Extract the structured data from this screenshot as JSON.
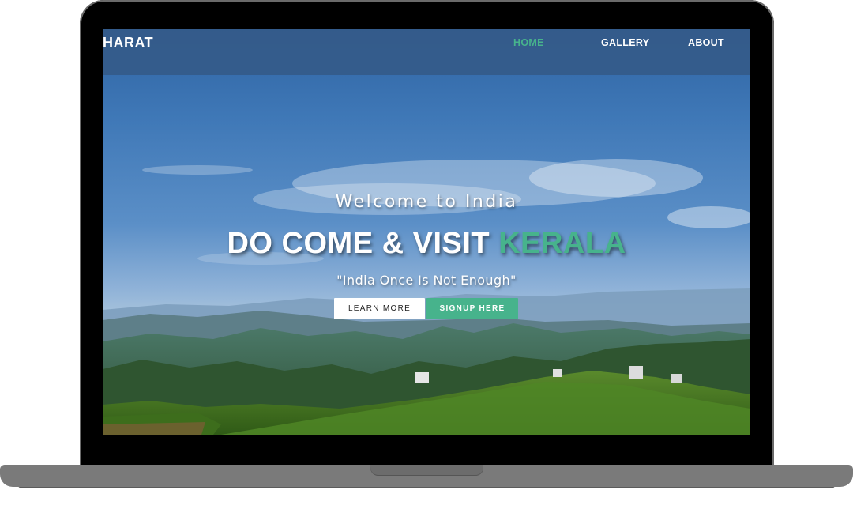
{
  "navbar": {
    "logo": "HARAT",
    "items": [
      {
        "label": "HOME",
        "active": true
      },
      {
        "label": "GALLERY",
        "active": false
      },
      {
        "label": "ABOUT",
        "active": false
      }
    ]
  },
  "hero": {
    "subtitle": "Welcome to India",
    "title_main": "DO COME & VISIT ",
    "title_accent": "KERALA",
    "quote": "\"India Once Is Not Enough\"",
    "buttons": {
      "learn_more": "LEARN MORE",
      "signup": "SIGNUP HERE"
    }
  },
  "colors": {
    "accent": "#47b38c",
    "navbar": "#345a88",
    "sky": "#3f78b7"
  }
}
